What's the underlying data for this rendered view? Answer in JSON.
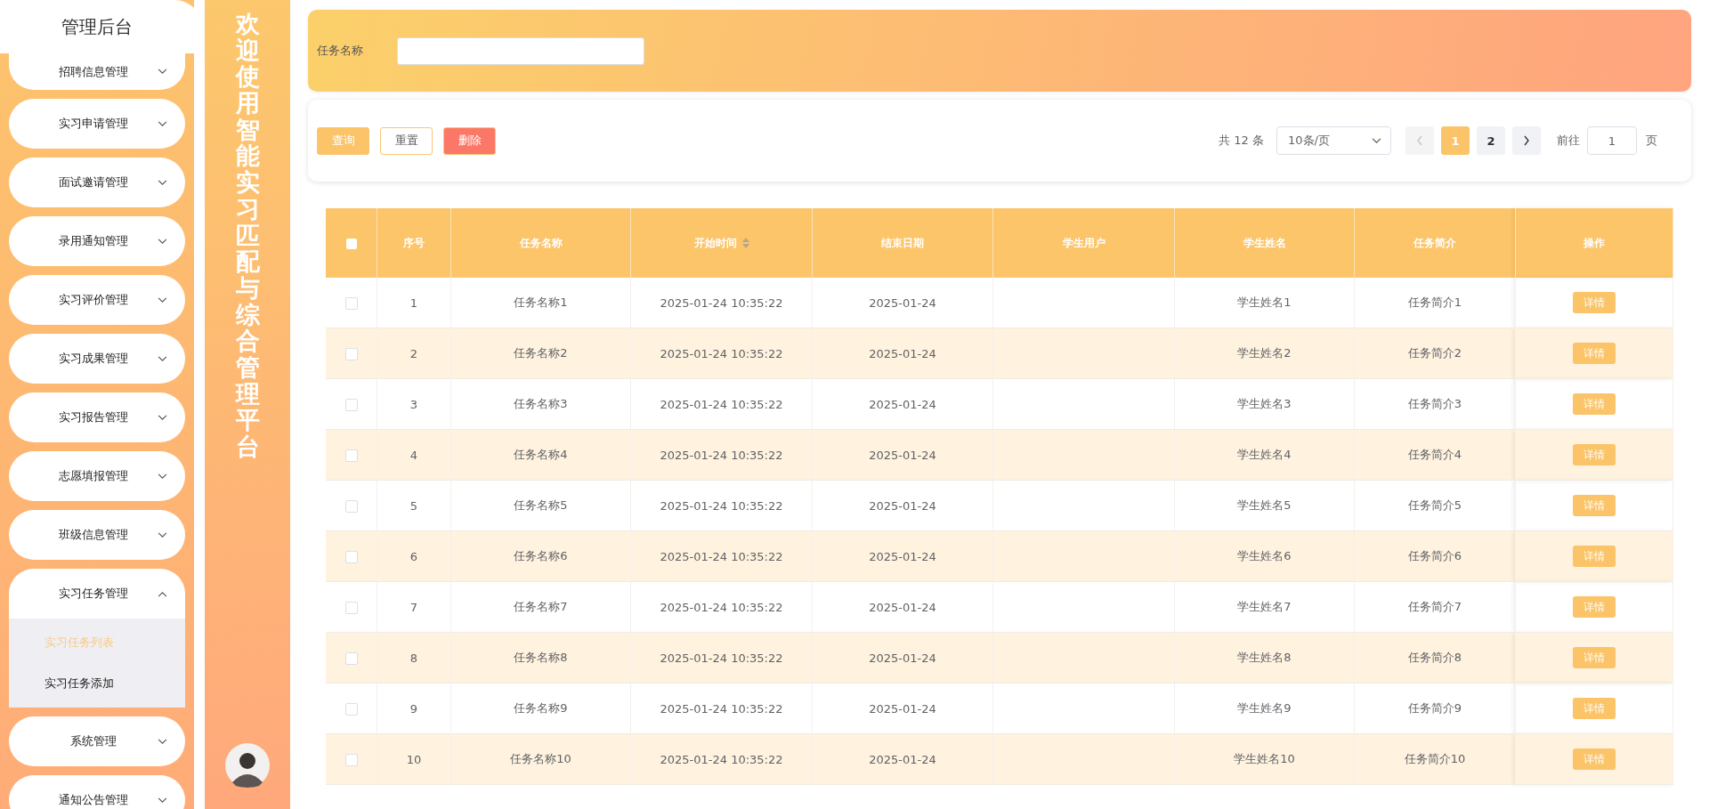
{
  "sidebar": {
    "title": "管理后台",
    "menu": [
      {
        "label": "招聘信息管理",
        "expanded": false
      },
      {
        "label": "实习申请管理",
        "expanded": false
      },
      {
        "label": "面试邀请管理",
        "expanded": false
      },
      {
        "label": "录用通知管理",
        "expanded": false
      },
      {
        "label": "实习评价管理",
        "expanded": false
      },
      {
        "label": "实习成果管理",
        "expanded": false
      },
      {
        "label": "实习报告管理",
        "expanded": false
      },
      {
        "label": "志愿填报管理",
        "expanded": false
      },
      {
        "label": "班级信息管理",
        "expanded": false
      },
      {
        "label": "实习任务管理",
        "expanded": true,
        "children": [
          {
            "label": "实习任务列表",
            "selected": true
          },
          {
            "label": "实习任务添加",
            "selected": false
          }
        ]
      },
      {
        "label": "系统管理",
        "expanded": false
      },
      {
        "label": "通知公告管理",
        "expanded": false
      }
    ]
  },
  "banner": {
    "title": "欢迎使用智能实习匹配与综合管理平台"
  },
  "search": {
    "label": "任务名称"
  },
  "toolbar": {
    "buttons": [
      {
        "label": "查询",
        "kind": "primary"
      },
      {
        "label": "重置",
        "kind": "plain"
      },
      {
        "label": "删除",
        "kind": "danger"
      }
    ]
  },
  "pagination": {
    "total": "共 12 条",
    "page_size": "10条/页",
    "prev_disabled": true,
    "pages": [
      {
        "label": "1",
        "selected": true
      },
      {
        "label": "2",
        "selected": false
      }
    ],
    "goto_label": "前往",
    "goto_value": "1",
    "goto_suffix": "页"
  },
  "table": {
    "all_checked": false,
    "columns": [
      {
        "label": "序号",
        "sortable": false
      },
      {
        "label": "任务名称",
        "sortable": false
      },
      {
        "label": "开始时间",
        "sortable": true
      },
      {
        "label": "结束日期",
        "sortable": false
      },
      {
        "label": "学生用户",
        "sortable": false
      },
      {
        "label": "学生姓名",
        "sortable": false
      },
      {
        "label": "任务简介",
        "sortable": false
      },
      {
        "label": "操作",
        "sortable": false
      }
    ],
    "rows": [
      {
        "checked": false,
        "cells": [
          "1",
          "任务名称1",
          "2025-01-24 10:35:22",
          "2025-01-24",
          "",
          "学生姓名1",
          "任务简介1"
        ],
        "action": "详情"
      },
      {
        "checked": false,
        "cells": [
          "2",
          "任务名称2",
          "2025-01-24 10:35:22",
          "2025-01-24",
          "",
          "学生姓名2",
          "任务简介2"
        ],
        "action": "详情"
      },
      {
        "checked": false,
        "cells": [
          "3",
          "任务名称3",
          "2025-01-24 10:35:22",
          "2025-01-24",
          "",
          "学生姓名3",
          "任务简介3"
        ],
        "action": "详情"
      },
      {
        "checked": false,
        "cells": [
          "4",
          "任务名称4",
          "2025-01-24 10:35:22",
          "2025-01-24",
          "",
          "学生姓名4",
          "任务简介4"
        ],
        "action": "详情"
      },
      {
        "checked": false,
        "cells": [
          "5",
          "任务名称5",
          "2025-01-24 10:35:22",
          "2025-01-24",
          "",
          "学生姓名5",
          "任务简介5"
        ],
        "action": "详情"
      },
      {
        "checked": false,
        "cells": [
          "6",
          "任务名称6",
          "2025-01-24 10:35:22",
          "2025-01-24",
          "",
          "学生姓名6",
          "任务简介6"
        ],
        "action": "详情"
      },
      {
        "checked": false,
        "cells": [
          "7",
          "任务名称7",
          "2025-01-24 10:35:22",
          "2025-01-24",
          "",
          "学生姓名7",
          "任务简介7"
        ],
        "action": "详情"
      },
      {
        "checked": false,
        "cells": [
          "8",
          "任务名称8",
          "2025-01-24 10:35:22",
          "2025-01-24",
          "",
          "学生姓名8",
          "任务简介8"
        ],
        "action": "详情"
      },
      {
        "checked": false,
        "cells": [
          "9",
          "任务名称9",
          "2025-01-24 10:35:22",
          "2025-01-24",
          "",
          "学生姓名9",
          "任务简介9"
        ],
        "action": "详情"
      },
      {
        "checked": false,
        "cells": [
          "10",
          "任务名称10",
          "2025-01-24 10:35:22",
          "2025-01-24",
          "",
          "学生姓名10",
          "任务简介10"
        ],
        "action": "详情"
      }
    ]
  }
}
